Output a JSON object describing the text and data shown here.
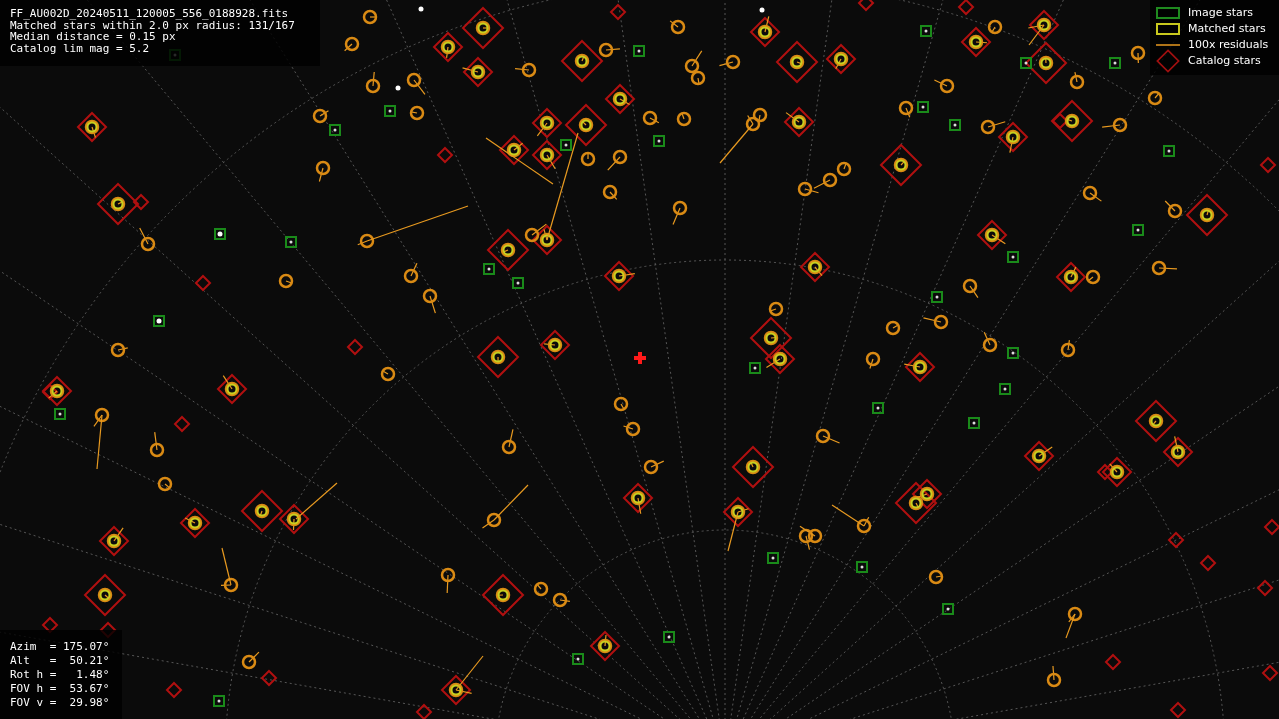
{
  "info": {
    "lines": [
      "FF_AU002D_20240511_120005_556_0188928.fits",
      "Matched stars within 2.0 px radius: 131/167",
      "Median distance = 0.15 px",
      "Catalog lim mag = 5.2"
    ]
  },
  "legend": [
    {
      "kind": "image",
      "label": "Image stars"
    },
    {
      "kind": "matched",
      "label": "Matched stars"
    },
    {
      "kind": "residual",
      "label": "100x residuals"
    },
    {
      "kind": "catalog",
      "label": "Catalog stars"
    }
  ],
  "pointing": {
    "lines": [
      "Azim  = 175.07°",
      "Alt   =  50.21°",
      "Rot h =   1.48°",
      "FOV h =  53.67°",
      "FOV v =  29.98°"
    ]
  }
}
